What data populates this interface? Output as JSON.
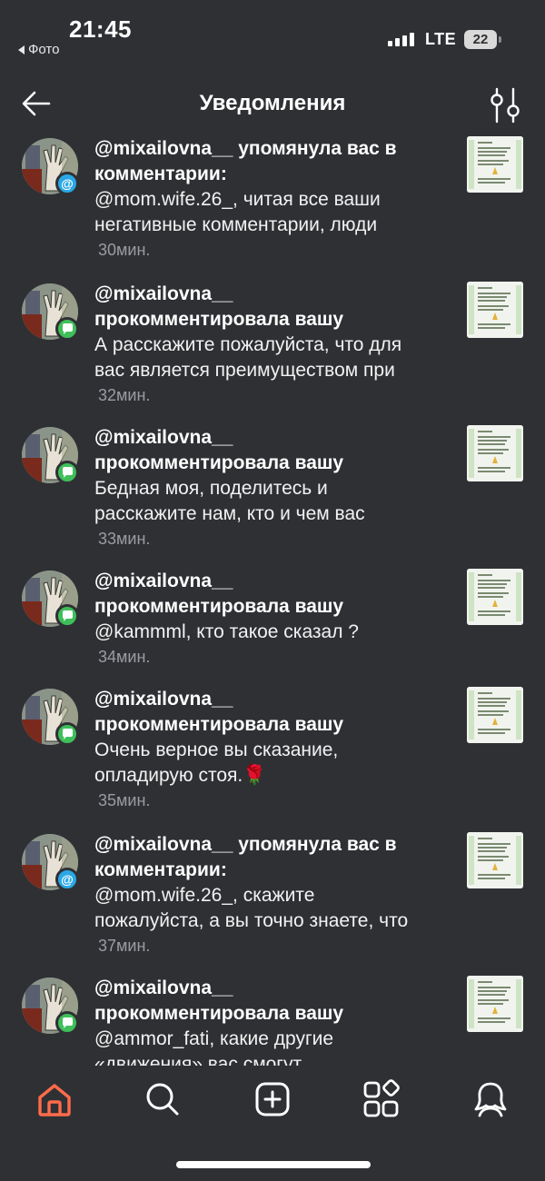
{
  "status_bar": {
    "time": "21:45",
    "back_app": "Фото",
    "network": "LTE",
    "battery": "22"
  },
  "header": {
    "title": "Уведомления",
    "back_icon": "arrow-left-icon",
    "filter_icon": "sliders-icon"
  },
  "notifications": [
    {
      "type": "mention",
      "title": "@mixailovna__ упомянула вас в комментарии:",
      "title_line1": "@mixailovna__ упомянула вас в",
      "title_line2": "комментарии:",
      "body_line1": "@mom.wife.26_, читая все ваши",
      "body_line2": "негативные комментарии, люди",
      "time": "30мин."
    },
    {
      "type": "comment",
      "title_line1": "@mixailovna__",
      "title_line2": "прокомментировала вашу",
      "body_line1": "А расскажите пожалуйста, что для",
      "body_line2": "вас является преимуществом при",
      "time": "32мин."
    },
    {
      "type": "comment",
      "title_line1": "@mixailovna__",
      "title_line2": "прокомментировала вашу",
      "body_line1": "Бедная моя, поделитесь и",
      "body_line2": "расскажите нам, кто и чем вас",
      "time": "33мин."
    },
    {
      "type": "comment",
      "title_line1": "@mixailovna__",
      "title_line2": "прокомментировала вашу",
      "body_line1": "@kammml, кто такое сказал ?",
      "body_line2": "",
      "time": "34мин."
    },
    {
      "type": "comment",
      "title_line1": "@mixailovna__",
      "title_line2": "прокомментировала вашу",
      "body_line1": "Очень верное вы сказание,",
      "body_line2": "опладирую стоя.🌹",
      "time": "35мин."
    },
    {
      "type": "mention",
      "title_line1": "@mixailovna__ упомянула вас в",
      "title_line2": "комментарии:",
      "body_line1": "@mom.wife.26_, скажите",
      "body_line2": "пожалуйста, а вы точно знаете, что",
      "time": "37мин."
    },
    {
      "type": "comment",
      "title_line1": "@mixailovna__",
      "title_line2": "прокомментировала вашу",
      "body_line1": "@ammor_fati, какие другие",
      "body_line2": "«движения» вас смогут",
      "time": ""
    }
  ],
  "bottom_nav": [
    {
      "name": "home",
      "icon": "home-icon",
      "active": true
    },
    {
      "name": "search",
      "icon": "search-icon",
      "active": false
    },
    {
      "name": "create",
      "icon": "plus-square-icon",
      "active": false
    },
    {
      "name": "apps",
      "icon": "grid-icon",
      "active": false
    },
    {
      "name": "profile",
      "icon": "profile-icon",
      "active": false
    }
  ],
  "colors": {
    "background": "#2f3034",
    "accent_home": "#ff6b4a",
    "mention_badge": "#2aa8e6",
    "comment_badge": "#3fbf5a",
    "muted_text": "#9a9ca2"
  }
}
